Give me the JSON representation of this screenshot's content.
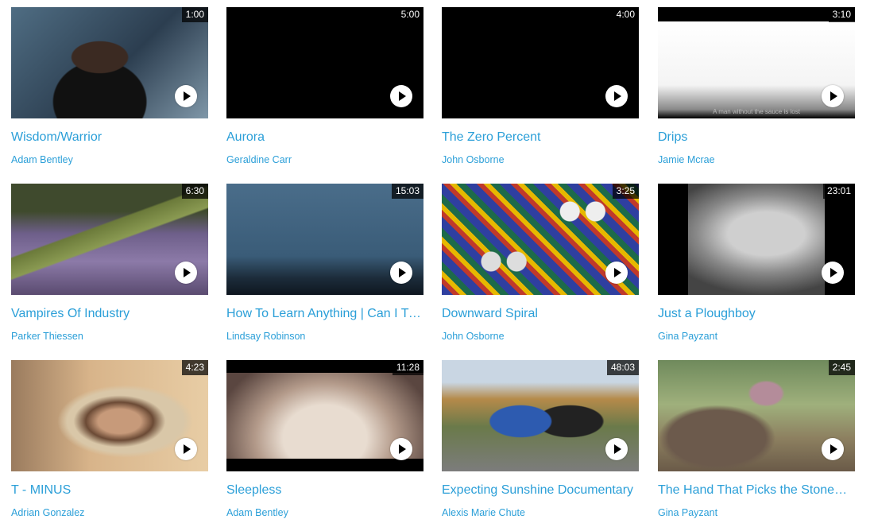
{
  "videos": [
    {
      "title": "Wisdom/Warrior",
      "author": "Adam Bentley",
      "duration": "1:00"
    },
    {
      "title": "Aurora",
      "author": "Geraldine Carr",
      "duration": "5:00"
    },
    {
      "title": "The Zero Percent",
      "author": "John Osborne",
      "duration": "4:00"
    },
    {
      "title": "Drips",
      "author": "Jamie Mcrae",
      "duration": "3:10",
      "caption": "A man without the sauce is lost"
    },
    {
      "title": "Vampires Of Industry",
      "author": "Parker Thiessen",
      "duration": "6:30"
    },
    {
      "title": "How To Learn Anything | Can I Tra...",
      "author": "Lindsay Robinson",
      "duration": "15:03"
    },
    {
      "title": "Downward Spiral",
      "author": "John Osborne",
      "duration": "3:25"
    },
    {
      "title": "Just a Ploughboy",
      "author": "Gina Payzant",
      "duration": "23:01"
    },
    {
      "title": "T - MINUS",
      "author": "Adrian Gonzalez",
      "duration": "4:23"
    },
    {
      "title": "Sleepless",
      "author": "Adam Bentley",
      "duration": "11:28"
    },
    {
      "title": "Expecting Sunshine Documentary",
      "author": "Alexis Marie Chute",
      "duration": "48:03"
    },
    {
      "title": "The Hand That Picks the Stones - ...",
      "author": "Gina Payzant",
      "duration": "2:45"
    }
  ],
  "accent_color": "#2b9fd8",
  "icons": {
    "play": "play-icon"
  }
}
